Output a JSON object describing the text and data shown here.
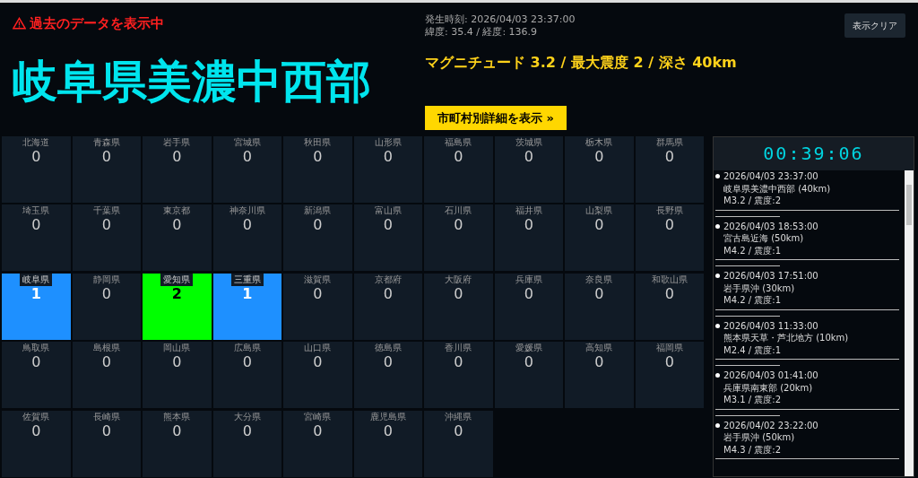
{
  "warning": "過去のデータを表示中",
  "region": "岐阜県美濃中西部",
  "occurred": "発生時刻: 2026/04/03 23:37:00",
  "coords": "緯度: 35.4 / 経度: 136.9",
  "summary": "マグニチュード 3.2 / 最大震度 2 / 深さ 40km",
  "detail_button": "市町村別詳細を表示 »",
  "clear_button": "表示クリア",
  "prefectures": [
    {
      "name": "北海道",
      "count": "0",
      "color": "#111b26"
    },
    {
      "name": "青森県",
      "count": "0",
      "color": "#111b26"
    },
    {
      "name": "岩手県",
      "count": "0",
      "color": "#111b26"
    },
    {
      "name": "宮城県",
      "count": "0",
      "color": "#111b26"
    },
    {
      "name": "秋田県",
      "count": "0",
      "color": "#111b26"
    },
    {
      "name": "山形県",
      "count": "0",
      "color": "#111b26"
    },
    {
      "name": "福島県",
      "count": "0",
      "color": "#111b26"
    },
    {
      "name": "茨城県",
      "count": "0",
      "color": "#111b26"
    },
    {
      "name": "栃木県",
      "count": "0",
      "color": "#111b26"
    },
    {
      "name": "群馬県",
      "count": "0",
      "color": "#111b26"
    },
    {
      "name": "埼玉県",
      "count": "0",
      "color": "#111b26"
    },
    {
      "name": "千葉県",
      "count": "0",
      "color": "#111b26"
    },
    {
      "name": "東京都",
      "count": "0",
      "color": "#111b26"
    },
    {
      "name": "神奈川県",
      "count": "0",
      "color": "#111b26"
    },
    {
      "name": "新潟県",
      "count": "0",
      "color": "#111b26"
    },
    {
      "name": "富山県",
      "count": "0",
      "color": "#111b26"
    },
    {
      "name": "石川県",
      "count": "0",
      "color": "#111b26"
    },
    {
      "name": "福井県",
      "count": "0",
      "color": "#111b26"
    },
    {
      "name": "山梨県",
      "count": "0",
      "color": "#111b26"
    },
    {
      "name": "長野県",
      "count": "0",
      "color": "#111b26"
    },
    {
      "name": "岐阜県",
      "count": "1",
      "color": "#1e90ff"
    },
    {
      "name": "静岡県",
      "count": "0",
      "color": "#111b26"
    },
    {
      "name": "愛知県",
      "count": "2",
      "color": "#00ff00"
    },
    {
      "name": "三重県",
      "count": "1",
      "color": "#1e90ff"
    },
    {
      "name": "滋賀県",
      "count": "0",
      "color": "#111b26"
    },
    {
      "name": "京都府",
      "count": "0",
      "color": "#111b26"
    },
    {
      "name": "大阪府",
      "count": "0",
      "color": "#111b26"
    },
    {
      "name": "兵庫県",
      "count": "0",
      "color": "#111b26"
    },
    {
      "name": "奈良県",
      "count": "0",
      "color": "#111b26"
    },
    {
      "name": "和歌山県",
      "count": "0",
      "color": "#111b26"
    },
    {
      "name": "鳥取県",
      "count": "0",
      "color": "#111b26"
    },
    {
      "name": "島根県",
      "count": "0",
      "color": "#111b26"
    },
    {
      "name": "岡山県",
      "count": "0",
      "color": "#111b26"
    },
    {
      "name": "広島県",
      "count": "0",
      "color": "#111b26"
    },
    {
      "name": "山口県",
      "count": "0",
      "color": "#111b26"
    },
    {
      "name": "徳島県",
      "count": "0",
      "color": "#111b26"
    },
    {
      "name": "香川県",
      "count": "0",
      "color": "#111b26"
    },
    {
      "name": "愛媛県",
      "count": "0",
      "color": "#111b26"
    },
    {
      "name": "高知県",
      "count": "0",
      "color": "#111b26"
    },
    {
      "name": "福岡県",
      "count": "0",
      "color": "#111b26"
    },
    {
      "name": "佐賀県",
      "count": "0",
      "color": "#111b26"
    },
    {
      "name": "長崎県",
      "count": "0",
      "color": "#111b26"
    },
    {
      "name": "熊本県",
      "count": "0",
      "color": "#111b26"
    },
    {
      "name": "大分県",
      "count": "0",
      "color": "#111b26"
    },
    {
      "name": "宮崎県",
      "count": "0",
      "color": "#111b26"
    },
    {
      "name": "鹿児島県",
      "count": "0",
      "color": "#111b26"
    },
    {
      "name": "沖縄県",
      "count": "0",
      "color": "#111b26"
    }
  ],
  "timer": "00:39:06",
  "history": [
    {
      "time": "2026/04/03 23:37:00",
      "place": "岐阜県美濃中西部 (40km)",
      "info": "M3.2 / 震度:2"
    },
    {
      "time": "2026/04/03 18:53:00",
      "place": "宮古島近海 (50km)",
      "info": "M4.2 / 震度:1"
    },
    {
      "time": "2026/04/03 17:51:00",
      "place": "岩手県沖 (30km)",
      "info": "M4.2 / 震度:1"
    },
    {
      "time": "2026/04/03 11:33:00",
      "place": "熊本県天草・芦北地方 (10km)",
      "info": "M2.4 / 震度:1"
    },
    {
      "time": "2026/04/03 01:41:00",
      "place": "兵庫県南東部 (20km)",
      "info": "M3.1 / 震度:2"
    },
    {
      "time": "2026/04/02 23:22:00",
      "place": "岩手県沖 (50km)",
      "info": "M4.3 / 震度:2"
    }
  ]
}
